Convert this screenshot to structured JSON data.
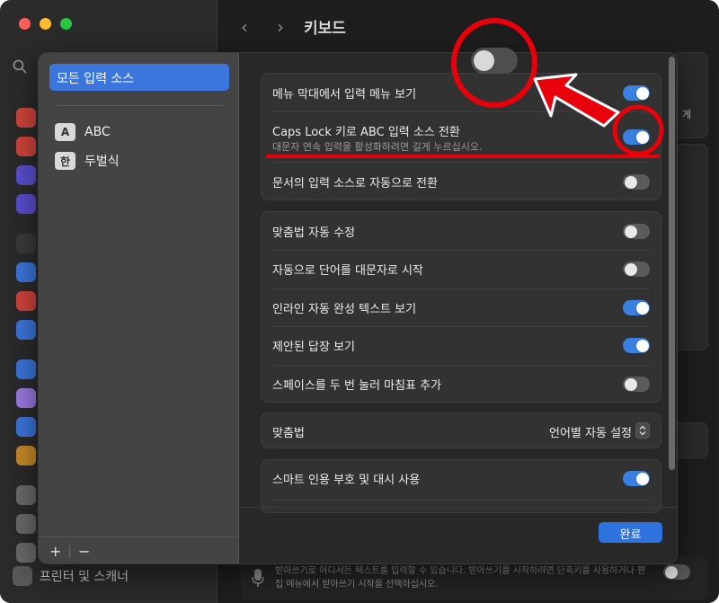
{
  "window": {
    "title": "키보드",
    "back_label": "‹",
    "forward_label": "›"
  },
  "background": {
    "bottom_sidebar_label": "프린터 및 스캐너",
    "dictation_text": "받아쓰기로 어디서든 텍스트를 입력할 수 있습니다. 받아쓰기를 시작하려면 단축키를 사용하거나 편집 메뉴에서 받아쓰기 시작을 선택하십시오.",
    "right_strip_text": "게"
  },
  "sources": {
    "all_label": "모든 입력 소스",
    "items": [
      {
        "badge": "A",
        "label": "ABC"
      },
      {
        "badge": "한",
        "label": "두벌식"
      }
    ],
    "add_label": "+",
    "remove_label": "−"
  },
  "settings": {
    "group1": [
      {
        "label": "메뉴 막대에서 입력 메뉴 보기",
        "on": true
      },
      {
        "label": "Caps Lock 키로 ABC 입력 소스 전환",
        "sub": "대문자 연속 입력을 활성화하려면 길게 누르십시오.",
        "on": true
      },
      {
        "label": "문서의 입력 소스로 자동으로 전환",
        "on": false
      }
    ],
    "group2": [
      {
        "label": "맞춤법 자동 수정",
        "on": false
      },
      {
        "label": "자동으로 단어를 대문자로 시작",
        "on": false
      },
      {
        "label": "인라인 자동 완성 텍스트 보기",
        "on": true
      },
      {
        "label": "제안된 답장 보기",
        "on": true
      },
      {
        "label": "스페이스를 두 번 눌러 마침표 추가",
        "on": false
      }
    ],
    "spelling": {
      "label": "맞춤법",
      "value": "언어별 자동 설정"
    },
    "group4": [
      {
        "label": "스마트 인용 부호 및 대시 사용",
        "on": true
      }
    ]
  },
  "done_label": "완료",
  "callout_toggle": {
    "on": false
  },
  "colors": {
    "accent": "#3a80e0",
    "annotation": "#e8000b",
    "selection": "#3b76dc"
  }
}
